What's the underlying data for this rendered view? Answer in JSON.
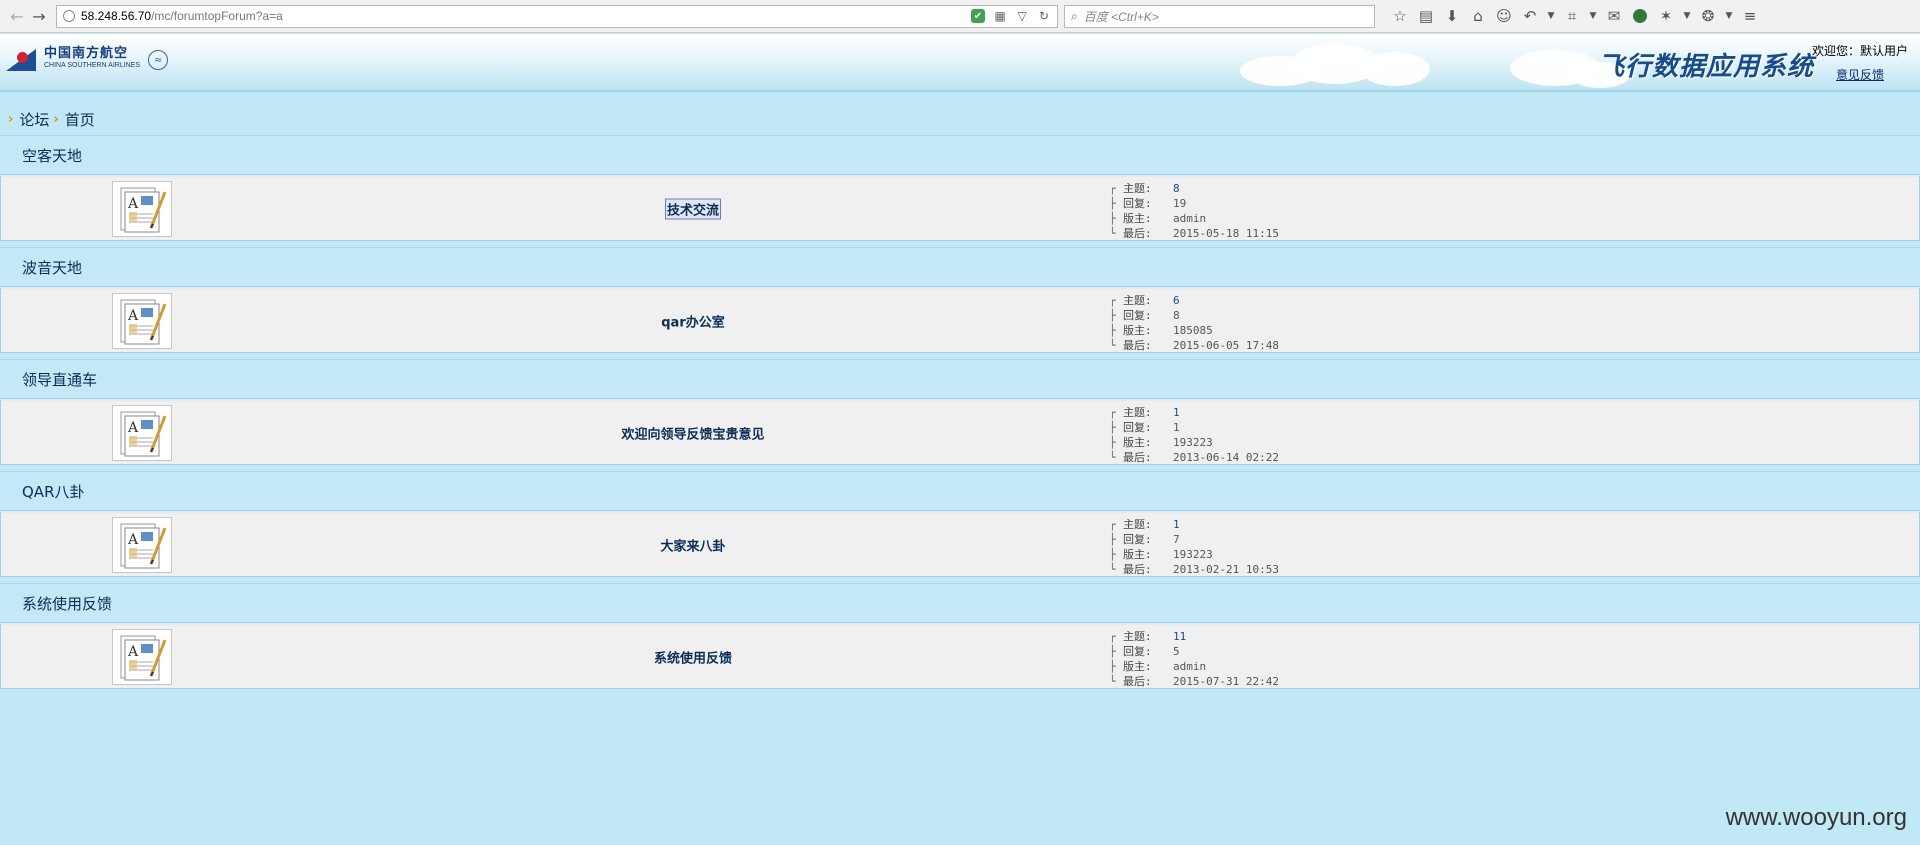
{
  "browser": {
    "url_host": "58.248.56.70",
    "url_path": "/mc/forumtopForum?a=a",
    "search_placeholder": "百度 <Ctrl+K>"
  },
  "header": {
    "logo_cn": "中国南方航空",
    "logo_en": "CHINA SOUTHERN AIRLINES",
    "system_title": "飞行数据应用系统",
    "welcome": "欢迎您：默认用户",
    "feedback_link": "意见反馈"
  },
  "breadcrumb": {
    "items": [
      "论坛",
      "首页"
    ]
  },
  "stat_labels": {
    "topics": "主题:",
    "replies": "回复:",
    "moderator": "版主:",
    "last": "最后:"
  },
  "categories": [
    {
      "title": "空客天地",
      "forum": {
        "name": "技术交流",
        "topics": "8",
        "replies": "19",
        "moderator": "admin",
        "last": "2015-05-18 11:15"
      }
    },
    {
      "title": "波音天地",
      "forum": {
        "name": "qar办公室",
        "topics": "6",
        "replies": "8",
        "moderator": "185085",
        "last": "2015-06-05 17:48"
      }
    },
    {
      "title": "领导直通车",
      "forum": {
        "name": "欢迎向领导反馈宝贵意见",
        "topics": "1",
        "replies": "1",
        "moderator": "193223",
        "last": "2013-06-14 02:22"
      }
    },
    {
      "title": "QAR八卦",
      "forum": {
        "name": "大家来八卦",
        "topics": "1",
        "replies": "7",
        "moderator": "193223",
        "last": "2013-02-21 10:53"
      }
    },
    {
      "title": "系统使用反馈",
      "forum": {
        "name": "系统使用反馈",
        "topics": "11",
        "replies": "5",
        "moderator": "admin",
        "last": "2015-07-31 22:42"
      }
    }
  ],
  "watermark": "www.wooyun.org"
}
